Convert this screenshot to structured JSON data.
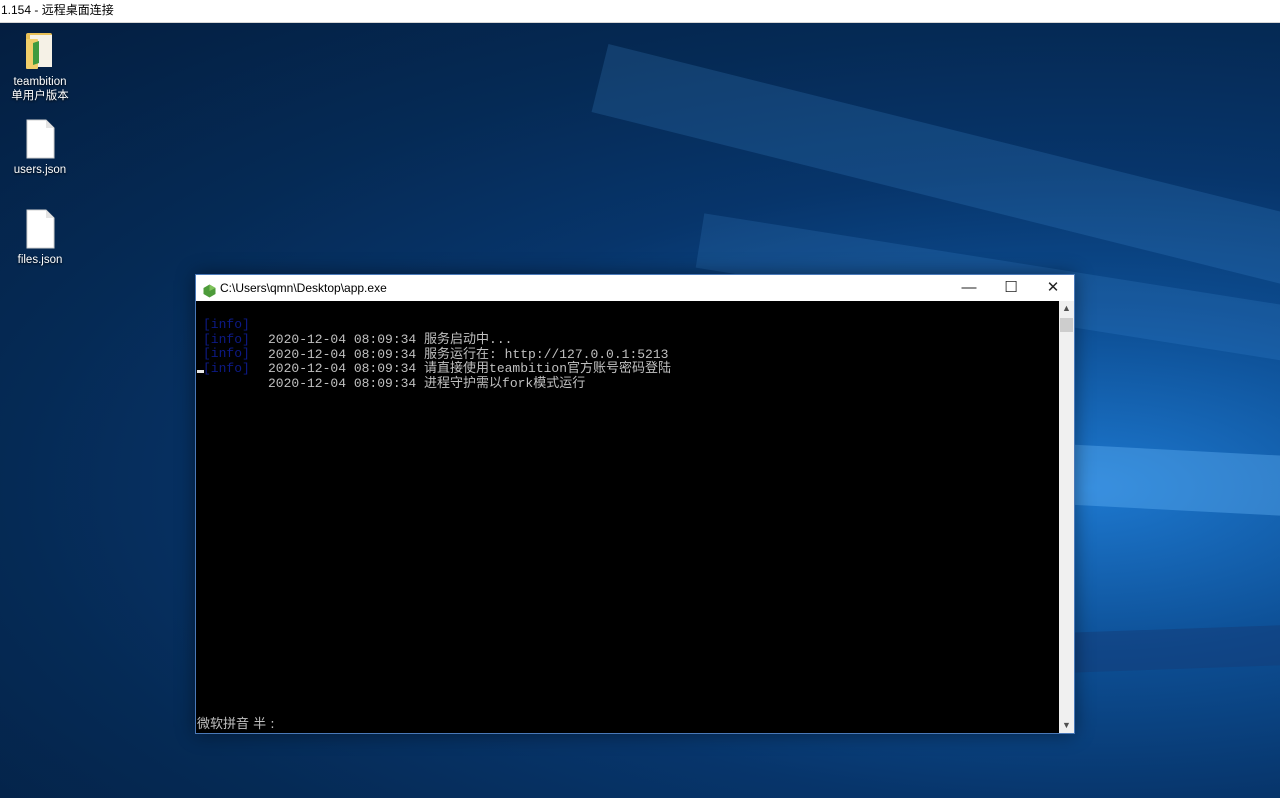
{
  "rdp_window": {
    "title": "1.154 - 远程桌面连接"
  },
  "desktop": {
    "icons": [
      {
        "label_line1": "teambition",
        "label_line2": "单用户版本",
        "icon": "folder-icon"
      },
      {
        "label_line1": "users.json",
        "icon": "file-icon"
      },
      {
        "label_line1": "files.json",
        "icon": "file-icon"
      }
    ]
  },
  "console": {
    "title": "C:\\Users\\qmn\\Desktop\\app.exe",
    "window_buttons": {
      "minimize": "—",
      "maximize": "☐",
      "close": "✕"
    },
    "log_lines": [
      {
        "level": "[info]",
        "message": "2020-12-04 08:09:34 服务启动中..."
      },
      {
        "level": "[info]",
        "message": "2020-12-04 08:09:34 服务运行在: http://127.0.0.1:5213"
      },
      {
        "level": "[info]",
        "message": "2020-12-04 08:09:34 请直接使用teambition官方账号密码登陆"
      },
      {
        "level": "[info]",
        "message": "2020-12-04 08:09:34 进程守护需以fork模式运行"
      }
    ],
    "ime_status": "微软拼音 半 :",
    "scroll_up": "▲",
    "scroll_down": "▼"
  },
  "colors": {
    "log_level": "#0d1a86",
    "console_text": "#c0c0c0",
    "window_border": "#4a79b8"
  }
}
